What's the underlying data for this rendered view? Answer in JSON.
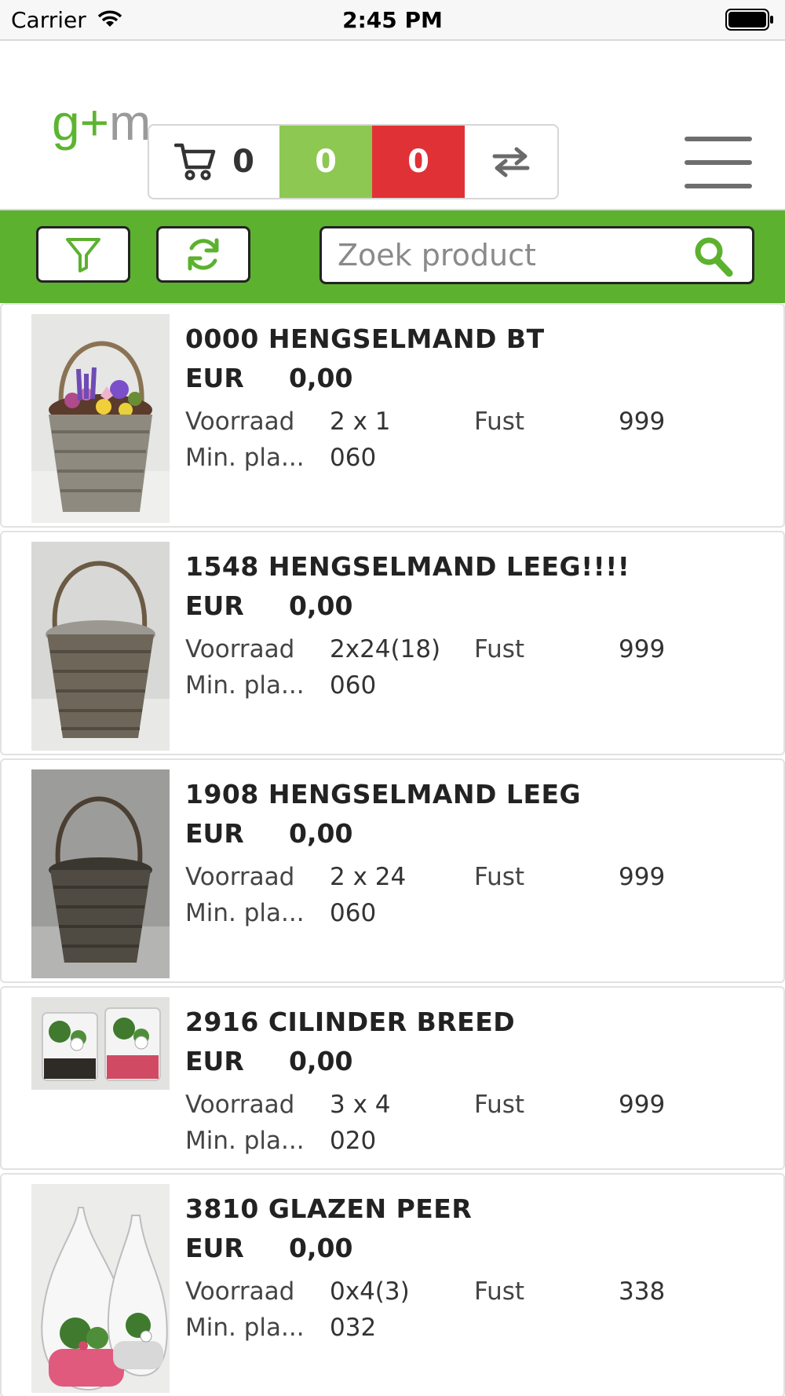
{
  "status_bar": {
    "carrier": "Carrier",
    "time": "2:45 PM"
  },
  "header": {
    "logo_text": "g+m",
    "cart_count": "0",
    "green_count": "0",
    "red_count": "0"
  },
  "toolbar": {
    "search": {
      "placeholder": "Zoek product",
      "value": ""
    }
  },
  "labels": {
    "currency": "EUR",
    "stock": "Voorraad",
    "crate": "Fust",
    "min_pla": "Min. pla..."
  },
  "colors": {
    "brand_green": "#5cb12f",
    "counter_green": "#8dc852",
    "counter_red": "#e03236"
  },
  "products": [
    {
      "title": "0000 HENGSELMAND BT",
      "price": "0,00",
      "stock": "2 x 1",
      "crate": "999",
      "min_pla": "060",
      "image": "basket-with-flowers"
    },
    {
      "title": "1548 HENGSELMAND LEEG!!!!",
      "price": "0,00",
      "stock": "2x24(18)",
      "crate": "999",
      "min_pla": "060",
      "image": "empty-basket"
    },
    {
      "title": "1908 HENGSELMAND LEEG",
      "price": "0,00",
      "stock": "2 x 24",
      "crate": "999",
      "min_pla": "060",
      "image": "empty-basket-dark"
    },
    {
      "title": "2916 CILINDER BREED",
      "price": "0,00",
      "stock": "3 x 4",
      "crate": "999",
      "min_pla": "020",
      "image": "glass-cylinders"
    },
    {
      "title": "3810 GLAZEN PEER",
      "price": "0,00",
      "stock": "0x4(3)",
      "crate": "338",
      "min_pla": "032",
      "image": "glass-pears"
    }
  ]
}
